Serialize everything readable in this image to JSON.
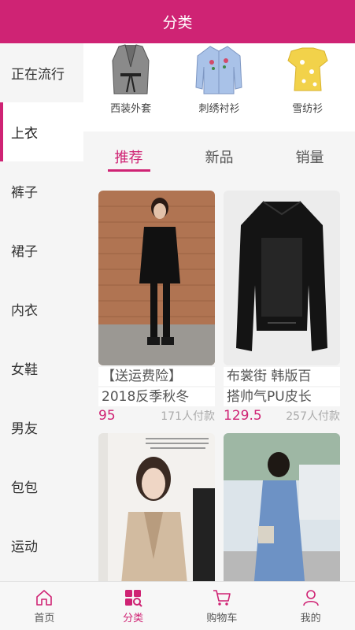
{
  "header": {
    "title": "分类"
  },
  "sidebar": {
    "items": [
      {
        "label": "正在流行"
      },
      {
        "label": "上衣"
      },
      {
        "label": "裤子"
      },
      {
        "label": "裙子"
      },
      {
        "label": "内衣"
      },
      {
        "label": "女鞋"
      },
      {
        "label": "男友"
      },
      {
        "label": "包包"
      },
      {
        "label": "运动"
      }
    ]
  },
  "subcategories": [
    {
      "label": "西装外套",
      "icon": "blazer-icon"
    },
    {
      "label": "刺绣衬衫",
      "icon": "embroidered-shirt-icon"
    },
    {
      "label": "雪纺衫",
      "icon": "chiffon-top-icon"
    }
  ],
  "tabs": [
    {
      "label": "推荐"
    },
    {
      "label": "新品"
    },
    {
      "label": "销量"
    }
  ],
  "products": [
    {
      "title": "【送运费险】",
      "subtitle": "2018反季秋冬",
      "price": "95",
      "sold": "171人付款"
    },
    {
      "title": "布裳街 韩版百",
      "subtitle": "搭帅气PU皮长",
      "price": "129.5",
      "sold": "257人付款"
    },
    {
      "title": "",
      "subtitle": "",
      "price": "",
      "sold": ""
    },
    {
      "title": "",
      "subtitle": "",
      "price": "",
      "sold": ""
    }
  ],
  "bottom_nav": [
    {
      "label": "首页",
      "icon": "home-icon"
    },
    {
      "label": "分类",
      "icon": "category-icon"
    },
    {
      "label": "购物车",
      "icon": "cart-icon"
    },
    {
      "label": "我的",
      "icon": "profile-icon"
    }
  ],
  "colors": {
    "accent": "#cf2374",
    "background": "#f5f5f5"
  }
}
